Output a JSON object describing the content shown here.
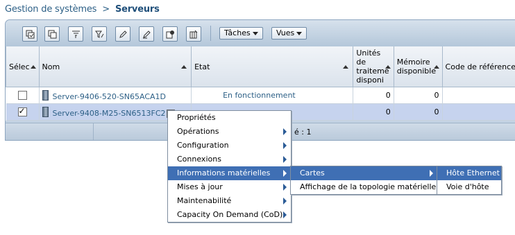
{
  "breadcrumb": {
    "root": "Gestion de systèmes",
    "separator": ">",
    "current": "Serveurs"
  },
  "toolbar": {
    "icons": [
      "select-all-icon",
      "copy-icon",
      "filter-icon",
      "filter-edit-icon",
      "edit-icon",
      "edit-sort-icon",
      "settings-icon",
      "columns-icon"
    ],
    "tasks_label": "Tâches",
    "views_label": "Vues"
  },
  "table": {
    "headers": {
      "select": "Sélec",
      "name": "Nom",
      "state": "Etat",
      "units_lines": [
        "Unités",
        "de",
        "traiteme",
        "disponi"
      ],
      "memory_lines": [
        "Mémoire",
        "disponible"
      ],
      "ref_code": "Code de référence"
    },
    "rows": [
      {
        "checked": false,
        "name": "Server-9406-520-SN65ACA1D",
        "state": "En fonctionnement",
        "units": "0",
        "memory": "0",
        "ref": ""
      },
      {
        "checked": true,
        "name": "Server-9408-M25-SN6513FC2",
        "more": "»",
        "state": "",
        "units": "0",
        "memory": "0",
        "ref": ""
      }
    ]
  },
  "status_bar": {
    "selected_text": "é : 1"
  },
  "context_menu": {
    "items": [
      {
        "label": "Propriétés",
        "submenu": false
      },
      {
        "label": "Opérations",
        "submenu": true
      },
      {
        "label": "Configuration",
        "submenu": true
      },
      {
        "label": "Connexions",
        "submenu": true
      },
      {
        "label": "Informations matérielles",
        "submenu": true,
        "active": true
      },
      {
        "label": "Mises à jour",
        "submenu": true
      },
      {
        "label": "Maintenabilité",
        "submenu": true
      },
      {
        "label": "Capacity On Demand (CoD)",
        "submenu": true
      }
    ]
  },
  "submenu_hardware": {
    "items": [
      {
        "label": "Cartes",
        "submenu": true,
        "active": true
      },
      {
        "label": "Affichage de la topologie matérielle",
        "submenu": false
      }
    ]
  },
  "submenu_cards": {
    "items": [
      {
        "label": "Hôte Ethernet",
        "active": true
      },
      {
        "label": "Voie d'hôte"
      }
    ]
  },
  "colors": {
    "accent": "#3f6fb4",
    "link": "#2c5f86",
    "selected_row": "#c6d3ee"
  }
}
